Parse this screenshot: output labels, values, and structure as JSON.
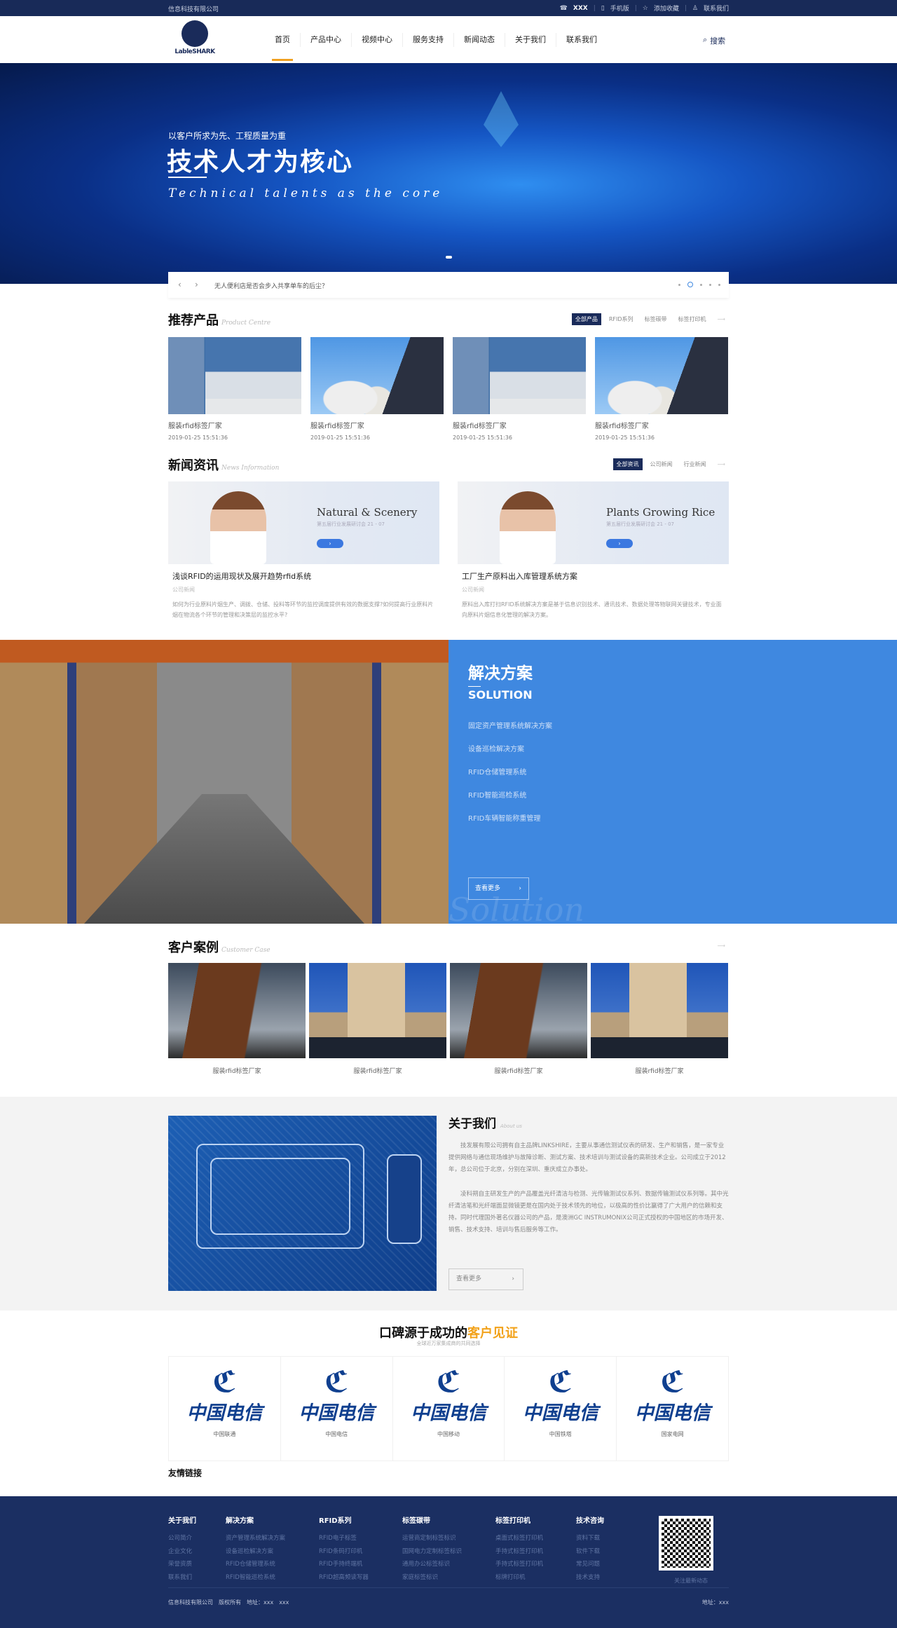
{
  "topbar": {
    "company": "信息科技有限公司",
    "phone": "XXX",
    "mobile": "手机版",
    "favorite": "添加收藏",
    "contact": "联系我们"
  },
  "header": {
    "logo_text": "LableSHARK",
    "nav": [
      "首页",
      "产品中心",
      "视频中心",
      "服务支持",
      "新闻动态",
      "关于我们",
      "联系我们"
    ],
    "active": 0,
    "search": "搜索"
  },
  "banner": {
    "subtitle": "以客户所求为先、工程质量为重",
    "title": "技术人才为核心",
    "english": "Technical talents as the core"
  },
  "ticker": {
    "text": "无人便利店是否会步入共享单车的后尘？"
  },
  "products": {
    "title": "推荐产品",
    "en": "Product Centre",
    "tabs": [
      "全部产品",
      "RFID系列",
      "标签碳带",
      "标签打印机"
    ],
    "items": [
      {
        "title": "服装rfid标签厂家",
        "date": "2019-01-25 15:51:36",
        "img": "office"
      },
      {
        "title": "服装rfid标签厂家",
        "date": "2019-01-25 15:51:36",
        "img": "silo"
      },
      {
        "title": "服装rfid标签厂家",
        "date": "2019-01-25 15:51:36",
        "img": "office"
      },
      {
        "title": "服装rfid标签厂家",
        "date": "2019-01-25 15:51:36",
        "img": "silo"
      }
    ]
  },
  "news": {
    "title": "新闻资讯",
    "en": "News Information",
    "tabs": [
      "全部资讯",
      "公司新闻",
      "行业新闻"
    ],
    "items": [
      {
        "banner_title": "Natural & Scenery",
        "banner_sub": "第五届行业发展研讨会 21 - 07",
        "title": "浅谈RFID的运用现状及展开趋势rfid系统",
        "category": "公司新闻",
        "desc": "如何为行业原料片烟生产、调拨、仓储、投料等环节的监控调度提供有效的数据支撑?如何提高行业原料片烟在物流各个环节的管理和决策层的监控水平?"
      },
      {
        "banner_title": "Plants Growing Rice",
        "banner_sub": "第五届行业发展研讨会 21 - 07",
        "title": "工厂生产原料出入库管理系统方案",
        "category": "公司新闻",
        "desc": "原料出入库打扫RFID系统解决方案是基于信息识别技术、通讯技术、数据处理等物联网关键技术，专业面向原料片烟信息化管理的解决方案。"
      }
    ]
  },
  "solution": {
    "title": "解决方案",
    "en": "SOLUTION",
    "items": [
      "固定资产管理系统解决方案",
      "设备巡检解决方案",
      "RFID仓储管理系统",
      "RFID智能巡检系统",
      "RFID车辆智能称重管理"
    ],
    "more": "查看更多",
    "watermark": "Solution",
    "color": "#3f88e0"
  },
  "cases": {
    "title": "客户案例",
    "en": "Customer Case",
    "items": [
      {
        "title": "服装rfid标签厂家",
        "img": "wynn"
      },
      {
        "title": "服装rfid标签厂家",
        "img": "hotel"
      },
      {
        "title": "服装rfid标签厂家",
        "img": "wynn"
      },
      {
        "title": "服装rfid标签厂家",
        "img": "hotel"
      }
    ]
  },
  "about": {
    "title": "关于我们",
    "en": "About us",
    "p1": "技发展有限公司拥有自主品牌LINKSHIRE，主要从事通信测试仪表的研发、生产和销售，是一家专业提供网络与通信现场维护与故障诊断、测试方案、技术培训与测试设备的高新技术企业。公司成立于2012年，总公司位于北京，分别在深圳、重庆成立办事处。",
    "p2": "凌科朔自主研发生产的产品覆盖光纤清洁与检测、光传输测试仪系列、数据传输测试仪系列等。其中光纤清洁笔和光纤端面显微镜更是在国内处于技术领先的地位，以极高的性价比赢得了广大用户的信赖和支持。同时代理国外著名仪器公司的产品，是澳洲GC INSTRUMONIX公司正式授权的中国地区的市场开发、销售、技术支持、培训与售后服务等工作。",
    "more": "查看更多"
  },
  "testimonial": {
    "title_a": "口碑源于成功的",
    "title_b": "客户见证",
    "subtitle": "全球近万家集成商的共同选择",
    "accent": "#f2a21a",
    "logo_text": "中国电信",
    "clients": [
      "中国联通",
      "中国电信",
      "中国移动",
      "中国铁塔",
      "国家电网"
    ]
  },
  "links_title": "友情链接",
  "footer": {
    "cols": [
      {
        "h": "关于我们",
        "items": [
          "公司简介",
          "企业文化",
          "荣誉资质",
          "联系我们"
        ]
      },
      {
        "h": "解决方案",
        "items": [
          "资产管理系统解决方案",
          "设备巡检解决方案",
          "RFID仓储管理系统",
          "RFID智能巡检系统"
        ]
      },
      {
        "h": "RFID系列",
        "items": [
          "RFID电子标签",
          "RFID条码打印机",
          "RFID手持终端机",
          "RFID超高频读写器"
        ]
      },
      {
        "h": "标签碳带",
        "items": [
          "运营商定制标签标识",
          "国网电力定制标签标识",
          "通用办公标签标识",
          "家庭标签标识"
        ]
      },
      {
        "h": "标签打印机",
        "items": [
          "桌面式标签打印机",
          "手持式标签打印机",
          "手持式标签打印机",
          "标牌打印机"
        ]
      },
      {
        "h": "技术咨询",
        "items": [
          "资料下载",
          "软件下载",
          "常见问题",
          "技术支持"
        ]
      }
    ],
    "qr_caption": "关注最新动态",
    "copyright": "信息科技有限公司　版权所有　地址：xxx　xxx",
    "address": "地址：xxx",
    "bg": "#1b2f62"
  }
}
